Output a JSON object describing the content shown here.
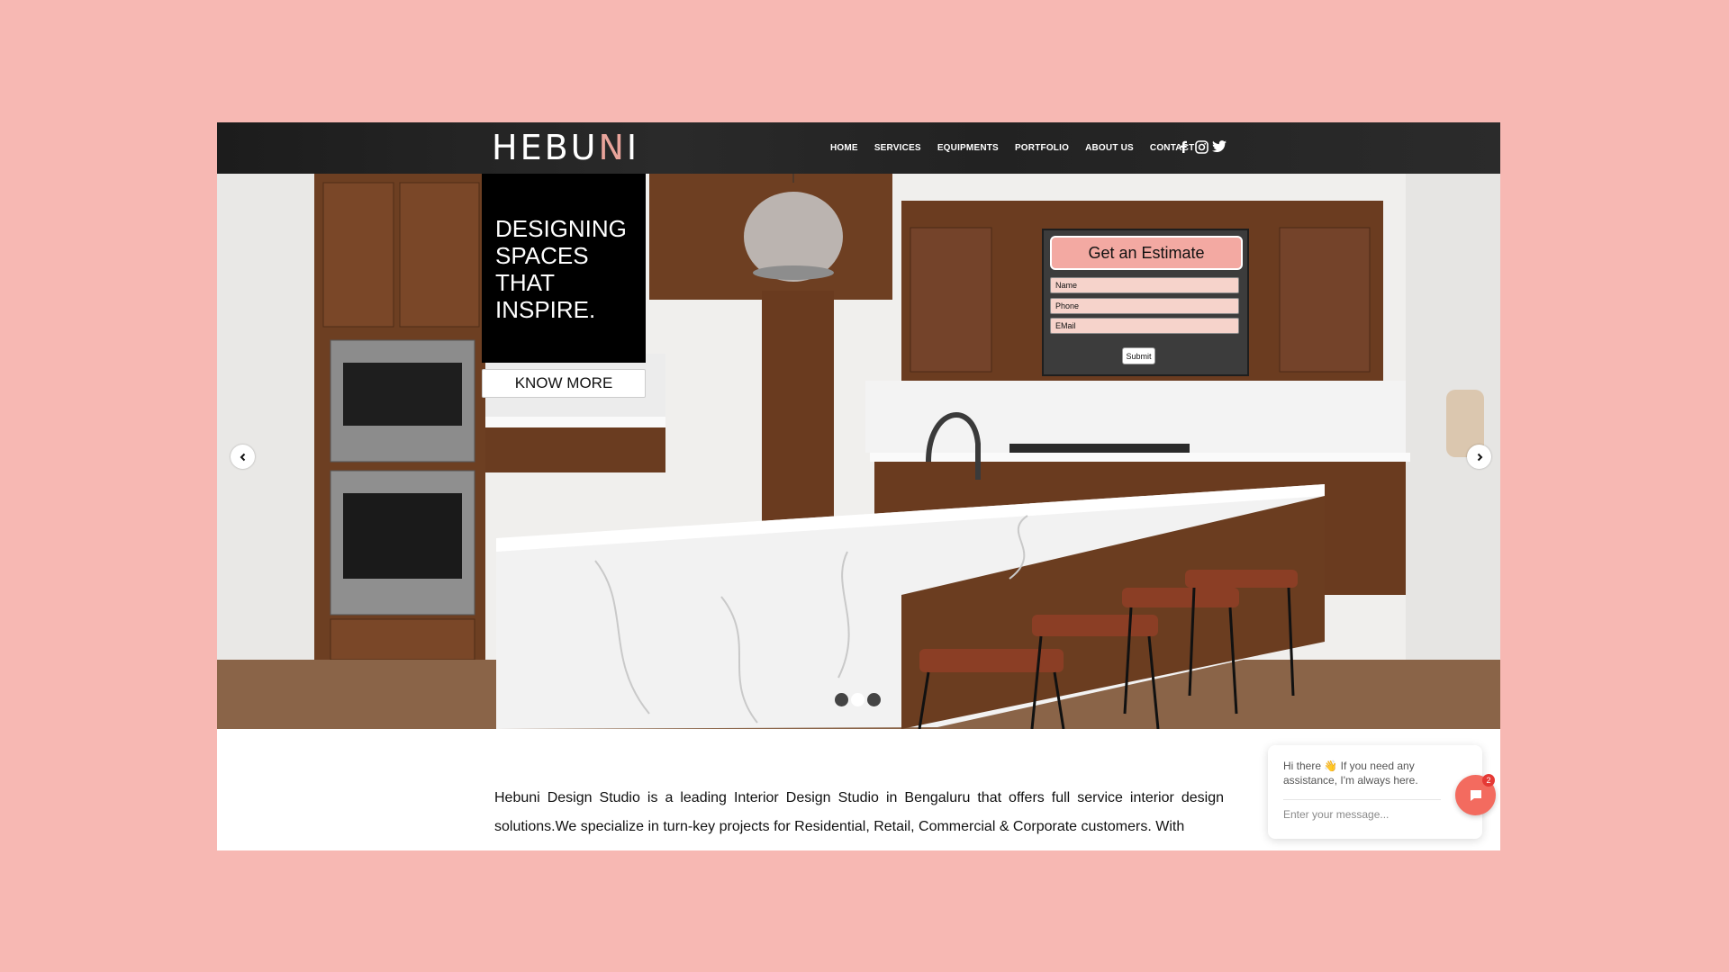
{
  "header": {
    "logo_text": "HEBU",
    "logo_accent": "N",
    "logo_end": "I",
    "nav": [
      "HOME",
      "SERVICES",
      "EQUIPMENTS",
      "PORTFOLIO",
      "ABOUT US",
      "CONTACT"
    ],
    "social_icons": [
      "facebook-icon",
      "instagram-icon",
      "twitter-icon"
    ]
  },
  "hero": {
    "tagline_lines": [
      "DESIGNING",
      "SPACES",
      "THAT",
      "INSPIRE."
    ],
    "know_more": "KNOW MORE",
    "estimate": {
      "title": "Get an Estimate",
      "fields": [
        "Name",
        "Phone",
        "EMail"
      ],
      "submit": "Submit"
    },
    "slides": 3,
    "active_slide": 2
  },
  "about": {
    "text": "Hebuni Design Studio is a leading Interior Design Studio in Bengaluru that offers full service interior design solutions.We specialize in turn-key projects for Residential, Retail, Commercial & Corporate customers. With"
  },
  "chat": {
    "greeting": "Hi there 👋 If you need any assistance, I'm always here.",
    "placeholder": "Enter your message...",
    "badge": "2"
  },
  "colors": {
    "page_bg": "#f7b8b3",
    "accent": "#f3a9a2",
    "chat_button": "#f36b5f"
  }
}
